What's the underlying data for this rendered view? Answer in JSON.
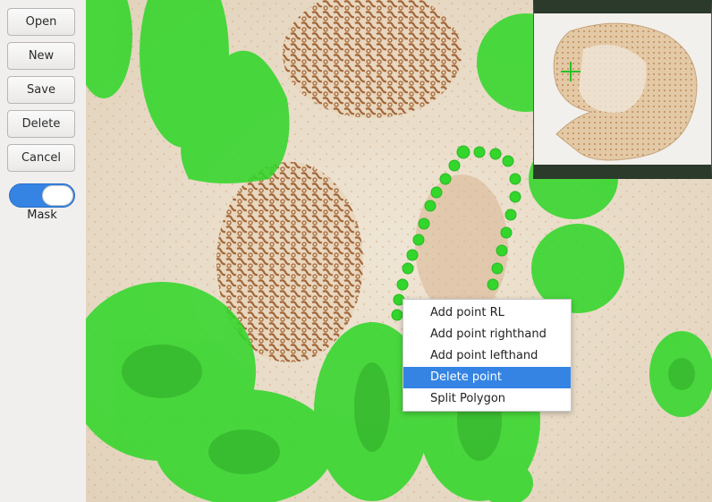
{
  "toolbar": {
    "open_label": "Open",
    "new_label": "New",
    "save_label": "Save",
    "delete_label": "Delete",
    "cancel_label": "Cancel",
    "mask_label": "Mask",
    "mask_on": true
  },
  "context_menu": {
    "items": [
      {
        "label": "Add point RL",
        "active": false
      },
      {
        "label": "Add point righthand",
        "active": false
      },
      {
        "label": "Add point lefthand",
        "active": false
      },
      {
        "label": "Delete point",
        "active": true
      },
      {
        "label": "Split Polygon",
        "active": false
      }
    ]
  },
  "colors": {
    "mask_green": "#33d62b",
    "accent": "#3584e4",
    "tissue_brown": "#a86a3a"
  }
}
